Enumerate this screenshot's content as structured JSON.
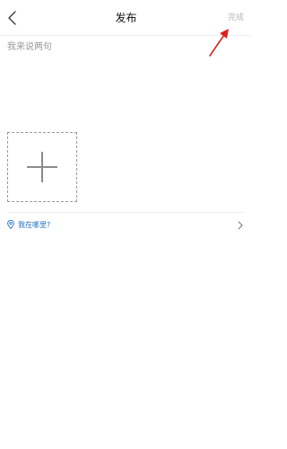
{
  "header": {
    "title": "发布",
    "done_label": "完成"
  },
  "composer": {
    "placeholder": "我来说两句",
    "value": ""
  },
  "location": {
    "label": "我在哪里?"
  },
  "icons": {
    "back": "chevron-left-icon",
    "add_photo": "plus-icon",
    "location": "location-pin-icon",
    "location_arrow": "chevron-right-icon",
    "annotation": "red-arrow"
  },
  "colors": {
    "location_text": "#1e72c8",
    "done_text": "#b5b5b5",
    "placeholder_text": "#9a9a9a",
    "annotation_arrow": "#e02020"
  }
}
